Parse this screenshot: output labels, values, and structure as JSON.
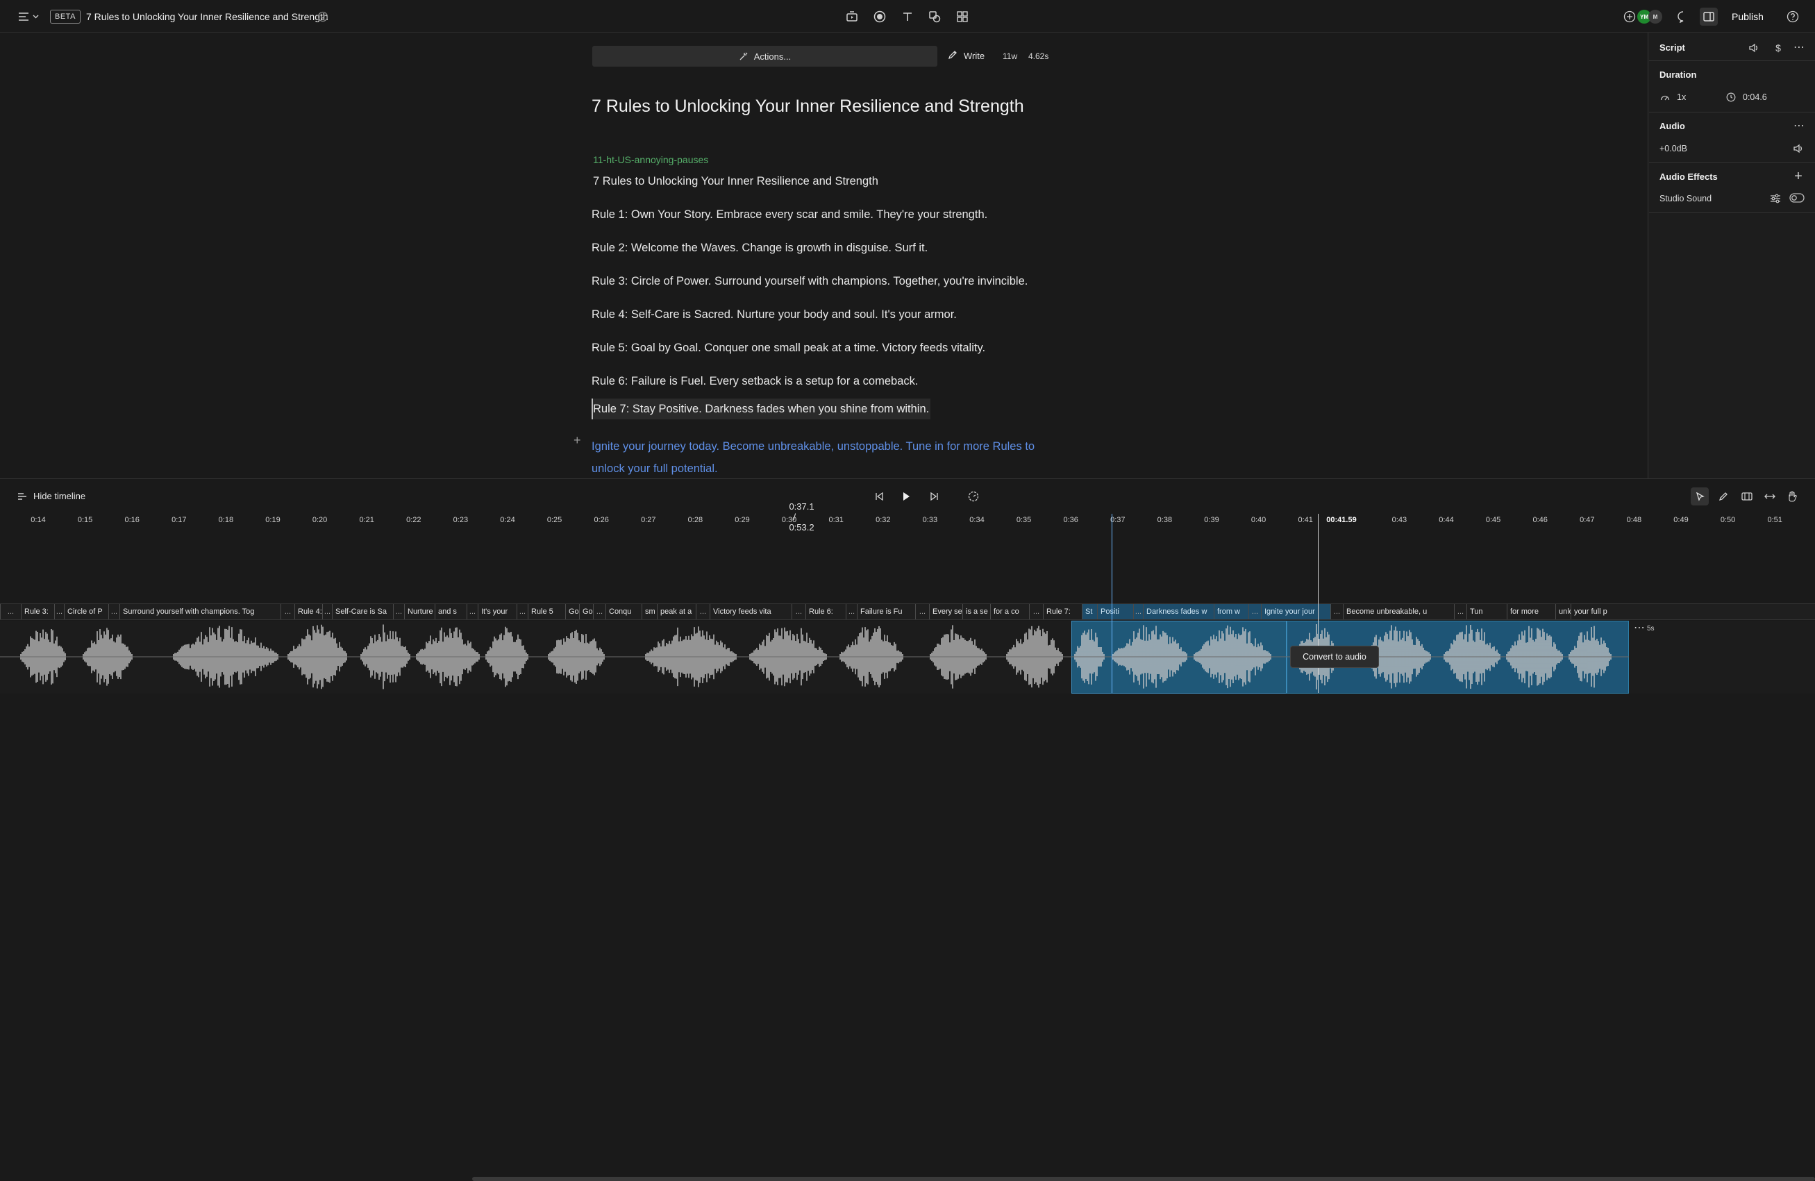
{
  "topbar": {
    "menu_icon": "hamburger-icon",
    "beta_label": "BETA",
    "doc_title": "7 Rules to Unlocking Your Inner Resilience and Strength",
    "publish_label": "Publish",
    "avatars": [
      {
        "initials": "YM",
        "color": "#1f8a2e"
      },
      {
        "initials": "M",
        "color": "#3a3a3a"
      }
    ]
  },
  "editor": {
    "actions_label": "Actions...",
    "write_label": "Write",
    "word_count": "11w",
    "duration": "4.62s",
    "title": "7 Rules to Unlocking Your Inner Resilience and Strength",
    "speaker": "11-ht-US-annoying-pauses",
    "paragraphs": [
      "7 Rules to Unlocking Your Inner Resilience and Strength",
      "Rule 1: Own Your Story. Embrace every scar and smile. They're your strength.",
      "Rule 2: Welcome the Waves. Change is growth in disguise. Surf it.",
      "Rule 3: Circle of Power. Surround yourself with champions. Together, you're invincible.",
      "Rule 4: Self-Care is Sacred. Nurture your body and soul. It's your armor.",
      "Rule 5: Goal by Goal. Conquer one small peak at a time. Victory feeds vitality.",
      "Rule 6: Failure is Fuel. Every setback is a setup for a comeback.",
      "Rule 7: Stay Positive. Darkness fades when you shine from within.",
      "Ignite your journey today. Become unbreakable, unstoppable. Tune in for more Rules to unlock your full potential."
    ]
  },
  "panel": {
    "script_label": "Script",
    "duration_label": "Duration",
    "speed": "1x",
    "time": "0:04.6",
    "audio_label": "Audio",
    "gain": "+0.0dB",
    "effects_label": "Audio Effects",
    "effect_name": "Studio Sound",
    "accent": "#4aa3df"
  },
  "timeline": {
    "hide_label": "Hide timeline",
    "current_time": "0:37.1",
    "separator": "/",
    "total_time": "0:53.2",
    "playhead_label": "00:41.59",
    "tooltip": "Convert to audio",
    "clip_badge": "5s",
    "ruler": [
      "0:14",
      "0:15",
      "0:16",
      "0:17",
      "0:18",
      "0:19",
      "0:20",
      "0:21",
      "0:22",
      "0:23",
      "0:24",
      "0:25",
      "0:26",
      "0:27",
      "0:28",
      "0:29",
      "0:30",
      "0:31",
      "0:32",
      "0:33",
      "0:34",
      "0:35",
      "0:36",
      "0:37",
      "0:38",
      "0:39",
      "0:40",
      "0:41",
      "00:41.59",
      "0:43",
      "0:44",
      "0:45",
      "0:46",
      "0:47",
      "0:48",
      "0:49",
      "0:50",
      "0:51"
    ],
    "words": [
      "...",
      "Rule 3:",
      "...",
      "Circle of P",
      "...",
      "Surround yourself with champions. Tog",
      "...",
      "Rule 4:",
      "...",
      "Self-Care is Sa",
      "...",
      "Nurture yo",
      "and s",
      "...",
      "It's your",
      "...",
      "Rule 5",
      "Goa",
      "Goa",
      "...",
      "Conqu",
      "sm",
      "peak at a",
      "...",
      "Victory feeds vita",
      "...",
      "Rule 6:",
      "...",
      "Failure is Fu",
      "...",
      "Every se",
      "is a se",
      "for a co",
      "...",
      "Rule 7:",
      "St",
      "Positi",
      "...",
      "Darkness fades w",
      "from w",
      "...",
      "Ignite your jour",
      "...",
      "Become unbreakable, u",
      "...",
      "Tun",
      "for more",
      "unlo",
      "your full p"
    ]
  }
}
